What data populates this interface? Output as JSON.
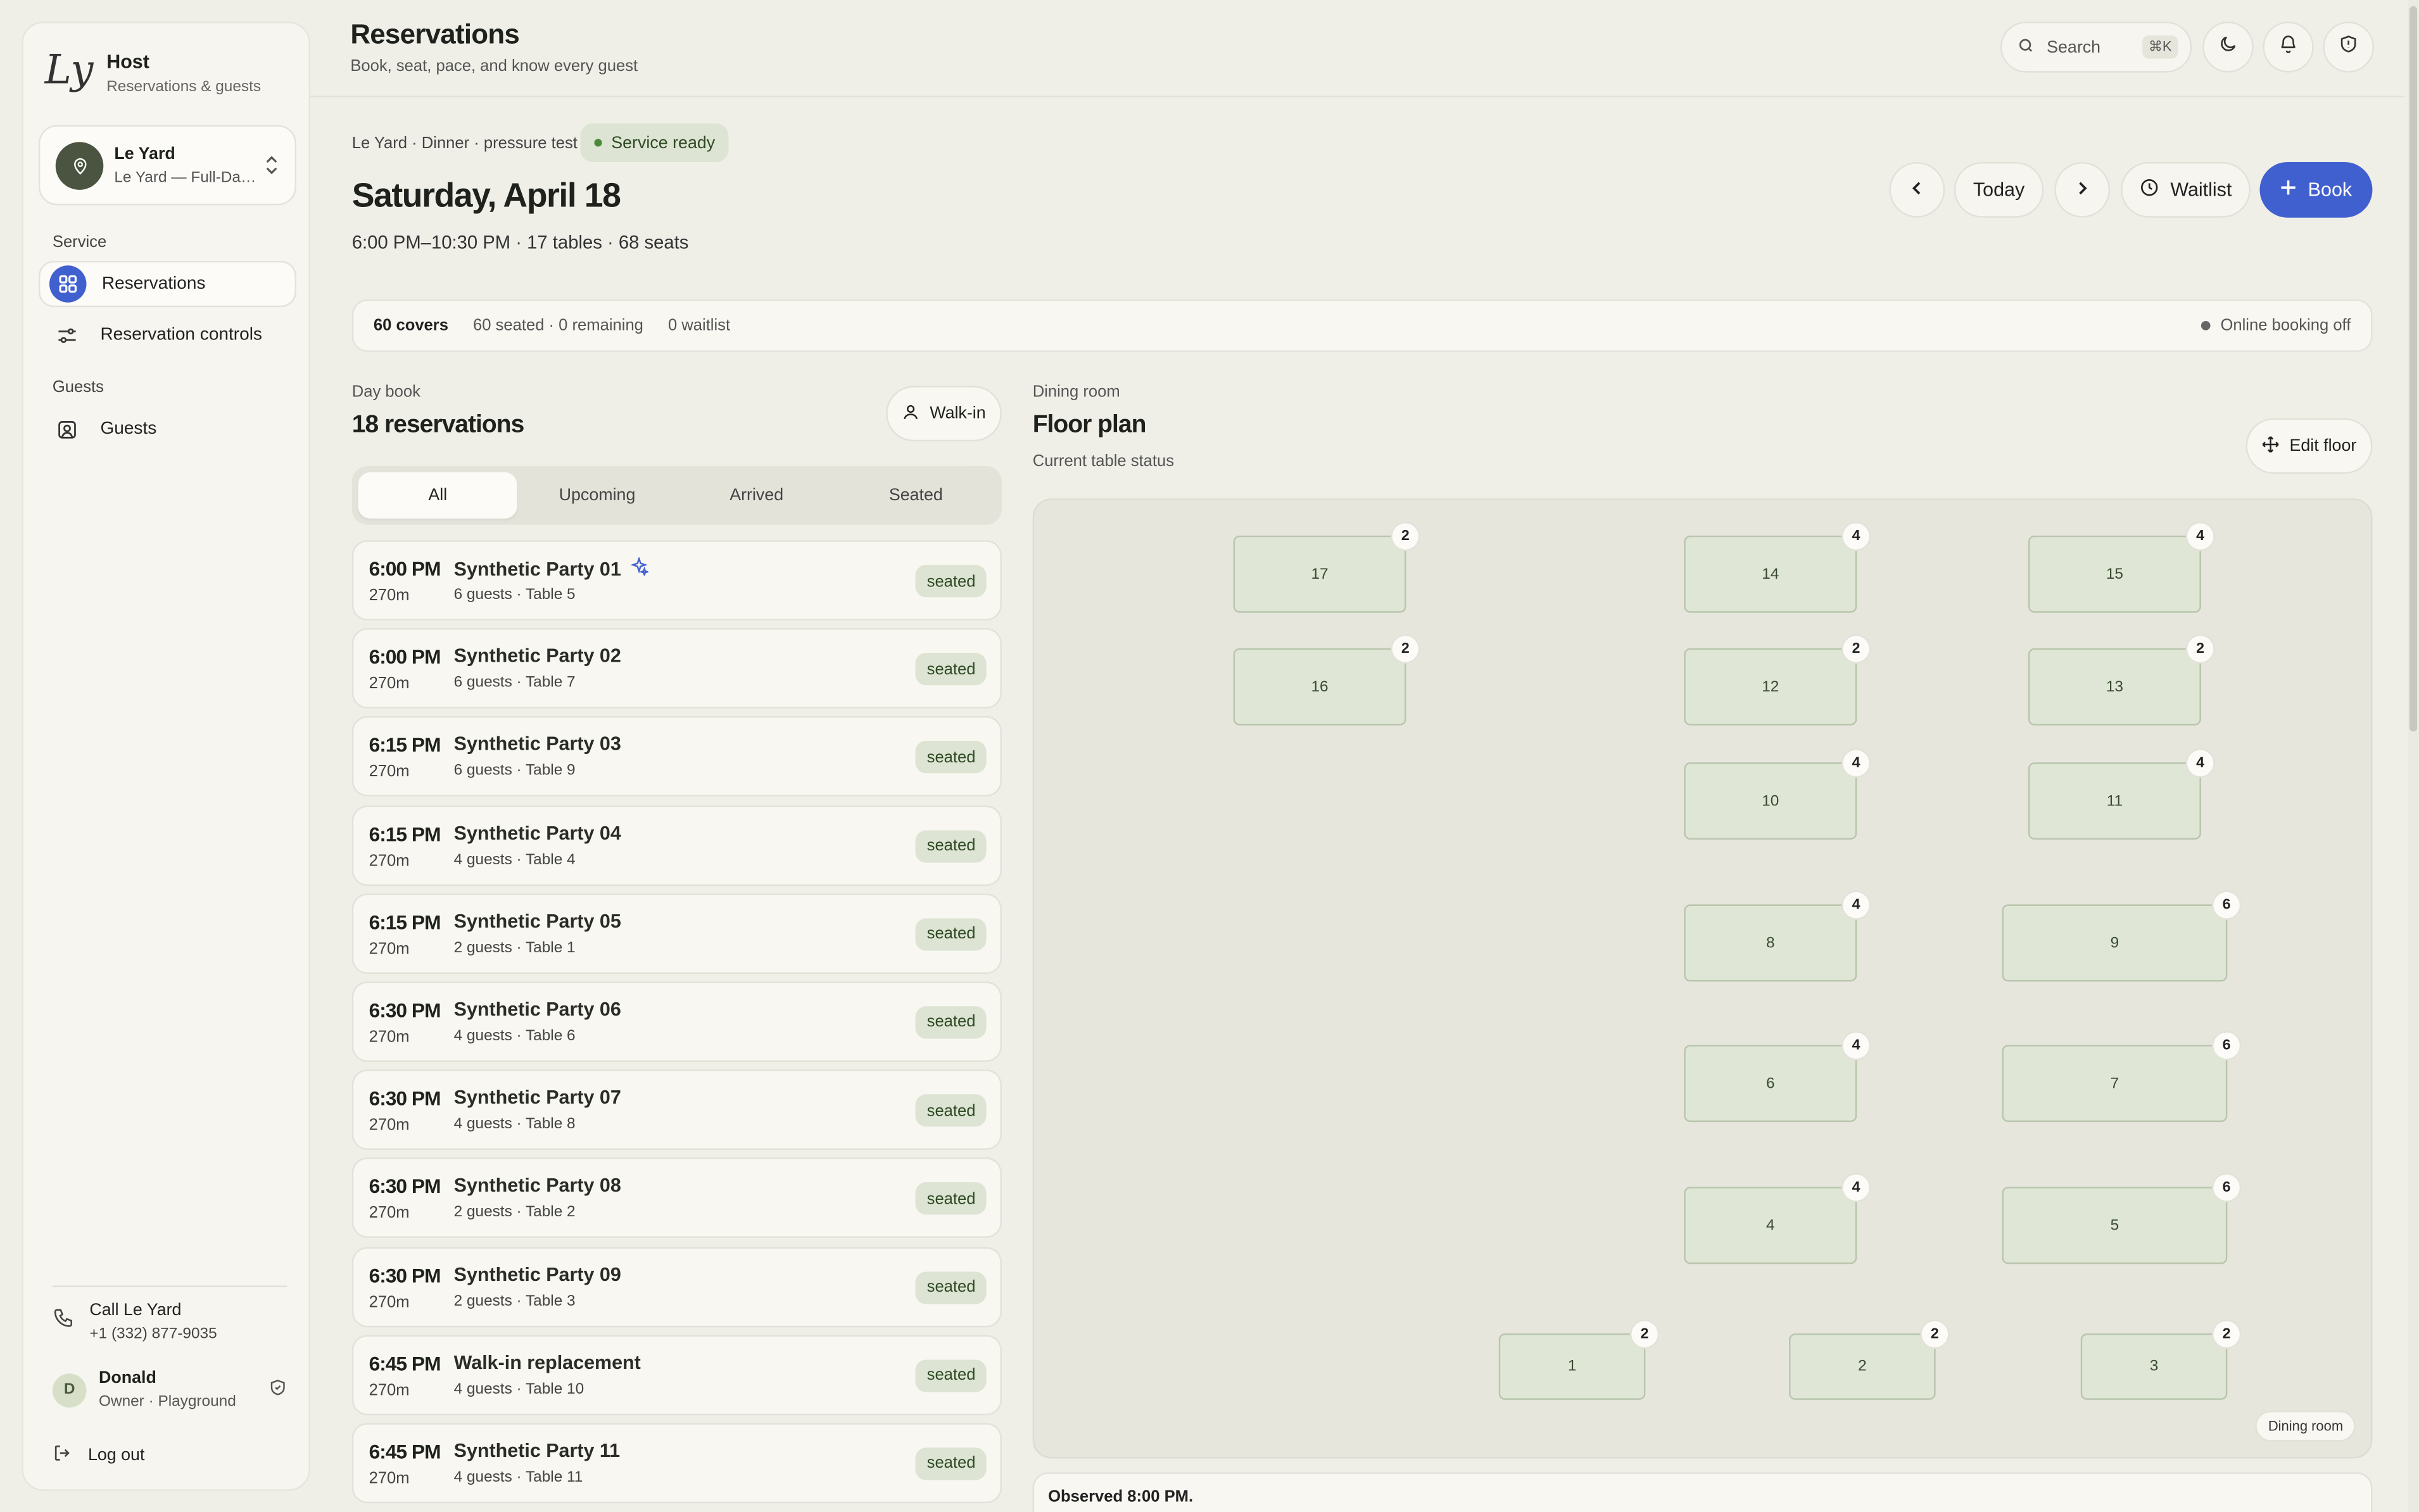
{
  "app": {
    "title": "Host",
    "subtitle": "Reservations & guests",
    "logo_text": "Ly"
  },
  "venue": {
    "name": "Le Yard",
    "location": "Le Yard — Full-Da…"
  },
  "nav": {
    "service_section": "Service",
    "guests_section": "Guests",
    "items": [
      {
        "label": "Reservations",
        "icon": "grid-icon",
        "active": true
      },
      {
        "label": "Reservation controls",
        "icon": "sliders-icon",
        "active": false
      },
      {
        "label": "Guests",
        "icon": "guest-card-icon",
        "active": false
      }
    ]
  },
  "contact": {
    "label": "Call Le Yard",
    "phone": "+1 (332) 877-9035"
  },
  "user": {
    "initial": "D",
    "name": "Donald",
    "role": "Owner · Playground"
  },
  "logout_label": "Log out",
  "header": {
    "title": "Reservations",
    "subtitle": "Book, seat, pace, and know every guest",
    "search_placeholder": "Search",
    "search_shortcut": "⌘K"
  },
  "service": {
    "breadcrumb": "Le Yard · Dinner · pressure test",
    "status": "Service ready",
    "date": "Saturday, April 18",
    "hours": "6:00 PM–10:30 PM · 17 tables · 68 seats"
  },
  "controls": {
    "today": "Today",
    "waitlist": "Waitlist",
    "book": "Book"
  },
  "stats": {
    "covers": "60 covers",
    "seated": "60 seated · 0 remaining",
    "waitlist": "0 waitlist",
    "online": "Online booking off"
  },
  "daybook": {
    "label": "Day book",
    "title": "18 reservations",
    "walkin": "Walk-in",
    "tabs": [
      "All",
      "Upcoming",
      "Arrived",
      "Seated"
    ],
    "active_tab": "All",
    "reservations": [
      {
        "time": "6:00 PM",
        "duration": "270m",
        "name": "Synthetic Party 01",
        "meta": "6 guests · Table 5",
        "status": "seated",
        "flag": true
      },
      {
        "time": "6:00 PM",
        "duration": "270m",
        "name": "Synthetic Party 02",
        "meta": "6 guests · Table 7",
        "status": "seated"
      },
      {
        "time": "6:15 PM",
        "duration": "270m",
        "name": "Synthetic Party 03",
        "meta": "6 guests · Table 9",
        "status": "seated"
      },
      {
        "time": "6:15 PM",
        "duration": "270m",
        "name": "Synthetic Party 04",
        "meta": "4 guests · Table 4",
        "status": "seated"
      },
      {
        "time": "6:15 PM",
        "duration": "270m",
        "name": "Synthetic Party 05",
        "meta": "2 guests · Table 1",
        "status": "seated"
      },
      {
        "time": "6:30 PM",
        "duration": "270m",
        "name": "Synthetic Party 06",
        "meta": "4 guests · Table 6",
        "status": "seated"
      },
      {
        "time": "6:30 PM",
        "duration": "270m",
        "name": "Synthetic Party 07",
        "meta": "4 guests · Table 8",
        "status": "seated"
      },
      {
        "time": "6:30 PM",
        "duration": "270m",
        "name": "Synthetic Party 08",
        "meta": "2 guests · Table 2",
        "status": "seated"
      },
      {
        "time": "6:30 PM",
        "duration": "270m",
        "name": "Synthetic Party 09",
        "meta": "2 guests · Table 3",
        "status": "seated"
      },
      {
        "time": "6:45 PM",
        "duration": "270m",
        "name": "Walk-in replacement",
        "meta": "4 guests · Table 10",
        "status": "seated"
      },
      {
        "time": "6:45 PM",
        "duration": "270m",
        "name": "Synthetic Party 11",
        "meta": "4 guests · Table 11",
        "status": "seated"
      }
    ]
  },
  "floor": {
    "label": "Dining room",
    "title": "Floor plan",
    "subtitle": "Current table status",
    "edit": "Edit floor",
    "room_tag": "Dining room",
    "tables": [
      {
        "id": "17",
        "seats": "2"
      },
      {
        "id": "14",
        "seats": "4"
      },
      {
        "id": "15",
        "seats": "4"
      },
      {
        "id": "16",
        "seats": "2"
      },
      {
        "id": "12",
        "seats": "2"
      },
      {
        "id": "13",
        "seats": "2"
      },
      {
        "id": "10",
        "seats": "4"
      },
      {
        "id": "11",
        "seats": "4"
      },
      {
        "id": "8",
        "seats": "4"
      },
      {
        "id": "9",
        "seats": "6"
      },
      {
        "id": "6",
        "seats": "4"
      },
      {
        "id": "7",
        "seats": "6"
      },
      {
        "id": "4",
        "seats": "4"
      },
      {
        "id": "5",
        "seats": "6"
      },
      {
        "id": "1",
        "seats": "2"
      },
      {
        "id": "2",
        "seats": "2"
      },
      {
        "id": "3",
        "seats": "2"
      }
    ]
  },
  "observed": "Observed 8:00 PM.",
  "colors": {
    "accent": "#4160d0",
    "badge_bg": "#dde4d3",
    "badge_text": "#2f4a24",
    "table_fill": "#dfe6d6"
  }
}
